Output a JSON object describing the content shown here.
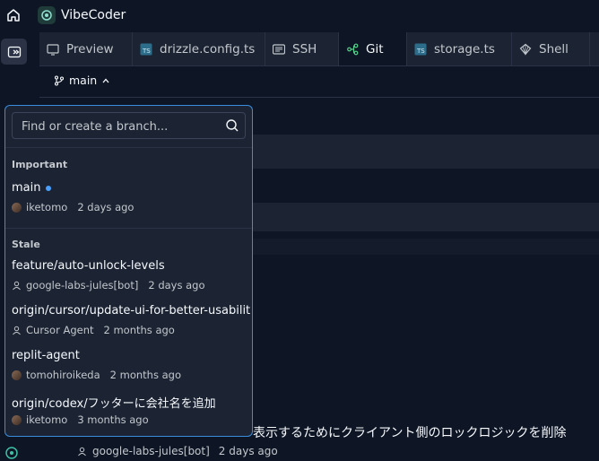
{
  "app": {
    "title": "VibeCoder"
  },
  "tabs": [
    {
      "label": "Preview",
      "icon": "preview-icon"
    },
    {
      "label": "drizzle.config.ts",
      "icon": "typescript-icon"
    },
    {
      "label": "SSH",
      "icon": "terminal-icon"
    },
    {
      "label": "Git",
      "icon": "git-icon",
      "active": true
    },
    {
      "label": "storage.ts",
      "icon": "typescript-icon"
    },
    {
      "label": "Shell",
      "icon": "shell-icon"
    }
  ],
  "branch": {
    "current": "main"
  },
  "popover": {
    "search_placeholder": "Find or create a branch...",
    "important_label": "Important",
    "stale_label": "Stale",
    "important": [
      {
        "name": "main",
        "author": "iketomo",
        "time": "2 days ago",
        "avatar": "photo"
      }
    ],
    "stale": [
      {
        "name": "feature/auto-unlock-levels",
        "author": "google-labs-jules[bot]",
        "time": "2 days ago",
        "avatar": "person"
      },
      {
        "name": "origin/cursor/update-ui-for-better-usabilit",
        "author": "Cursor Agent",
        "time": "2 months ago",
        "avatar": "person"
      },
      {
        "name": "replit-agent",
        "author": "tomohiroikeda",
        "time": "2 months ago",
        "avatar": "photo"
      },
      {
        "name": "origin/codex/フッターに会社名を追加",
        "author": "iketomo",
        "time": "3 months ago",
        "avatar": "photo"
      }
    ]
  },
  "background": {
    "commit_title_fragment": "表示するためにクライアント側のロックロジックを削除",
    "commit_author": "google-labs-jules[bot]",
    "commit_time": "2 days ago"
  },
  "colors": {
    "accent": "#3a8ddc",
    "panel": "#1c2333",
    "bg": "#0e1525",
    "dot": "#4aa0ff"
  }
}
